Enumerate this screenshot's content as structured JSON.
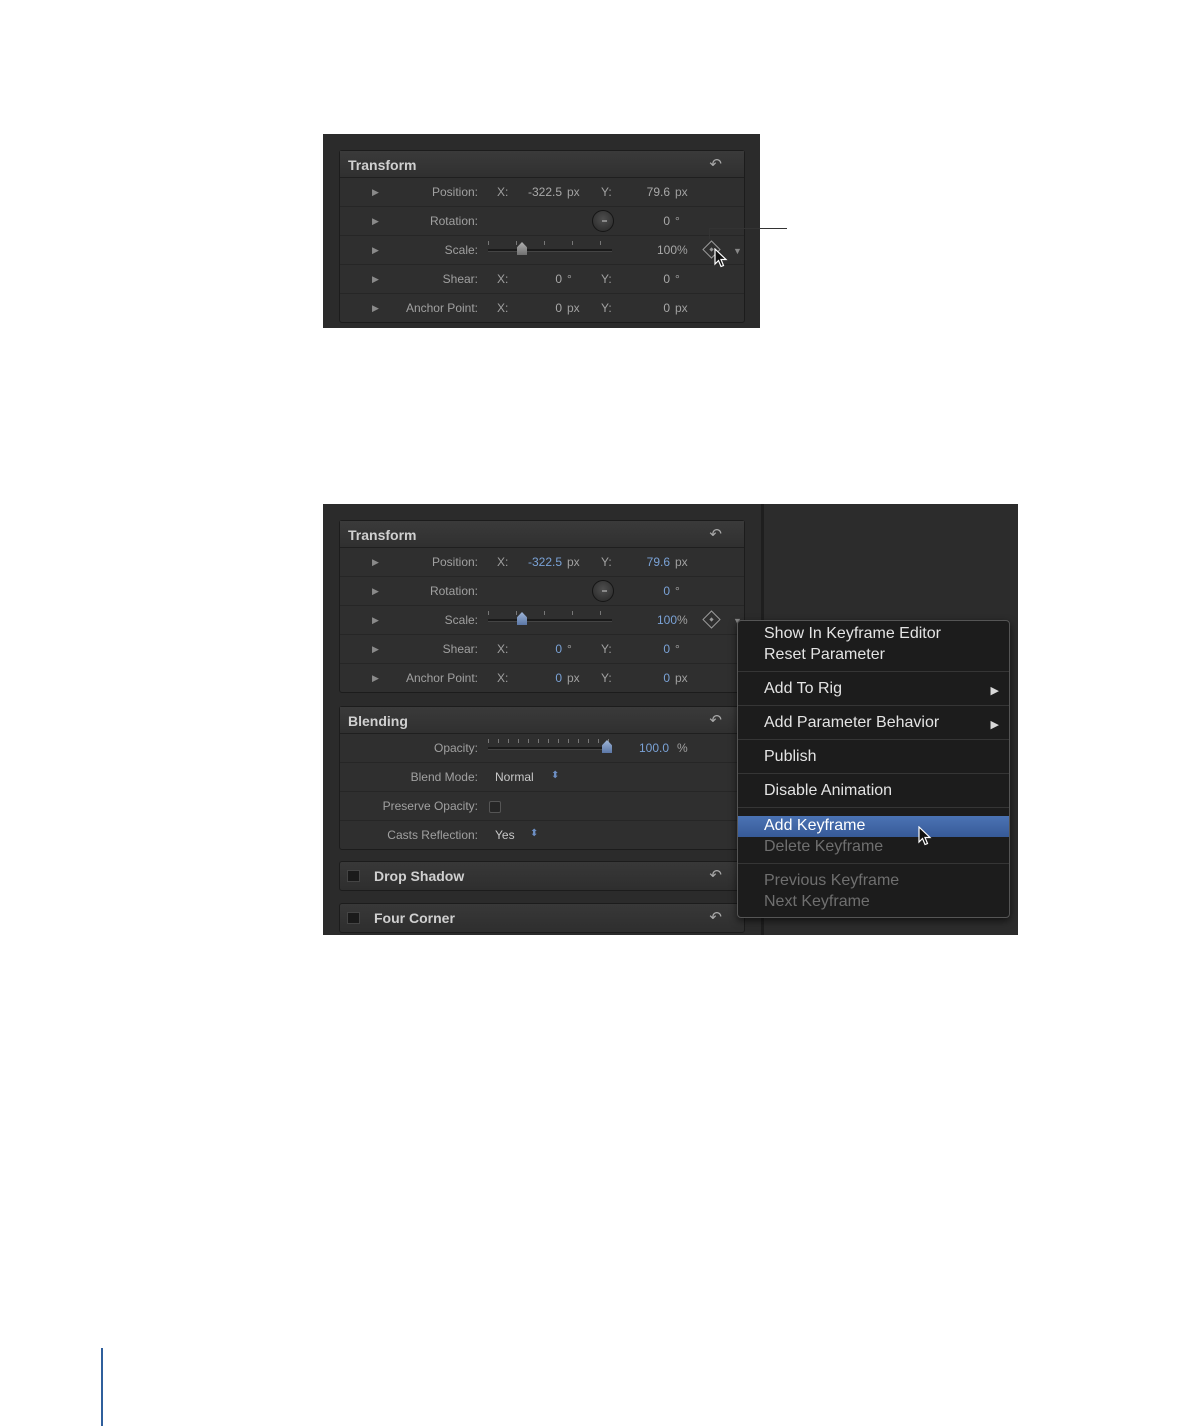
{
  "screenshot1": {
    "transform": {
      "title": "Transform",
      "reset_icon": "↶",
      "rows": {
        "position": {
          "label": "Position:",
          "x_label": "X:",
          "x_value": "-322.5",
          "x_unit": "px",
          "y_label": "Y:",
          "y_value": "79.6",
          "y_unit": "px"
        },
        "rotation": {
          "label": "Rotation:",
          "value": "0",
          "unit": "°"
        },
        "scale": {
          "label": "Scale:",
          "value": "100",
          "unit": "%"
        },
        "shear": {
          "label": "Shear:",
          "x_label": "X:",
          "x_value": "0",
          "x_unit": "°",
          "y_label": "Y:",
          "y_value": "0",
          "y_unit": "°"
        },
        "anchor": {
          "label": "Anchor Point:",
          "x_label": "X:",
          "x_value": "0",
          "x_unit": "px",
          "y_label": "Y:",
          "y_value": "0",
          "y_unit": "px"
        }
      }
    }
  },
  "screenshot2": {
    "transform": {
      "title": "Transform",
      "reset_icon": "↶",
      "rows": {
        "position": {
          "label": "Position:",
          "x_label": "X:",
          "x_value": "-322.5",
          "x_unit": "px",
          "y_label": "Y:",
          "y_value": "79.6",
          "y_unit": "px"
        },
        "rotation": {
          "label": "Rotation:",
          "value": "0",
          "unit": "°"
        },
        "scale": {
          "label": "Scale:",
          "value": "100",
          "unit": "%"
        },
        "shear": {
          "label": "Shear:",
          "x_label": "X:",
          "x_value": "0",
          "x_unit": "°",
          "y_label": "Y:",
          "y_value": "0",
          "y_unit": "°"
        },
        "anchor": {
          "label": "Anchor Point:",
          "x_label": "X:",
          "x_value": "0",
          "x_unit": "px",
          "y_label": "Y:",
          "y_value": "0",
          "y_unit": "px"
        }
      }
    },
    "blending": {
      "title": "Blending",
      "reset_icon": "↶",
      "opacity": {
        "label": "Opacity:",
        "value": "100.0",
        "unit": "%"
      },
      "blend_mode": {
        "label": "Blend Mode:",
        "value": "Normal"
      },
      "preserve_opacity": {
        "label": "Preserve Opacity:"
      },
      "casts_reflection": {
        "label": "Casts Reflection:",
        "value": "Yes"
      }
    },
    "drop_shadow": {
      "title": "Drop Shadow",
      "reset_icon": "↶"
    },
    "four_corner": {
      "title": "Four Corner",
      "reset_icon": "↶"
    },
    "menu": {
      "show_in_keyframe_editor": "Show In Keyframe Editor",
      "reset_parameter": "Reset Parameter",
      "add_to_rig": "Add To Rig",
      "add_parameter_behavior": "Add Parameter Behavior",
      "publish": "Publish",
      "disable_animation": "Disable Animation",
      "add_keyframe": "Add Keyframe",
      "delete_keyframe": "Delete Keyframe",
      "previous_keyframe": "Previous Keyframe",
      "next_keyframe": "Next Keyframe",
      "submenu_arrow": "▶"
    }
  },
  "icons": {
    "disclosure": "▶",
    "popup_arrows": "⬍",
    "dropdown": "▼"
  }
}
